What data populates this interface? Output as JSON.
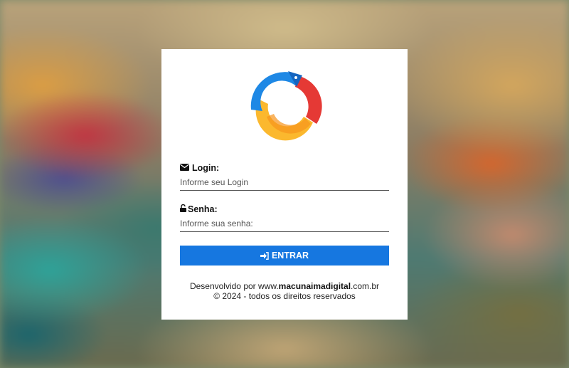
{
  "brand": {
    "logo_name": "macunaima-digital-logo",
    "colors": {
      "blue": "#1e88e5",
      "red": "#e53935",
      "yellow": "#fbc02d",
      "button": "#1677e0"
    }
  },
  "form": {
    "login_label": "Login:",
    "login_placeholder": "Informe seu Login",
    "password_label": "Senha:",
    "password_placeholder": "Informe sua senha:",
    "submit_label": "ENTRAR",
    "icons": {
      "login": "envelope-icon",
      "password": "unlock-icon",
      "submit": "sign-in-icon"
    }
  },
  "footer": {
    "prefix": "Desenvolvido por www.",
    "site_bold": "macunaimadigital",
    "suffix": ".com.br",
    "copyright": "© 2024 - todos os direitos reservados"
  }
}
